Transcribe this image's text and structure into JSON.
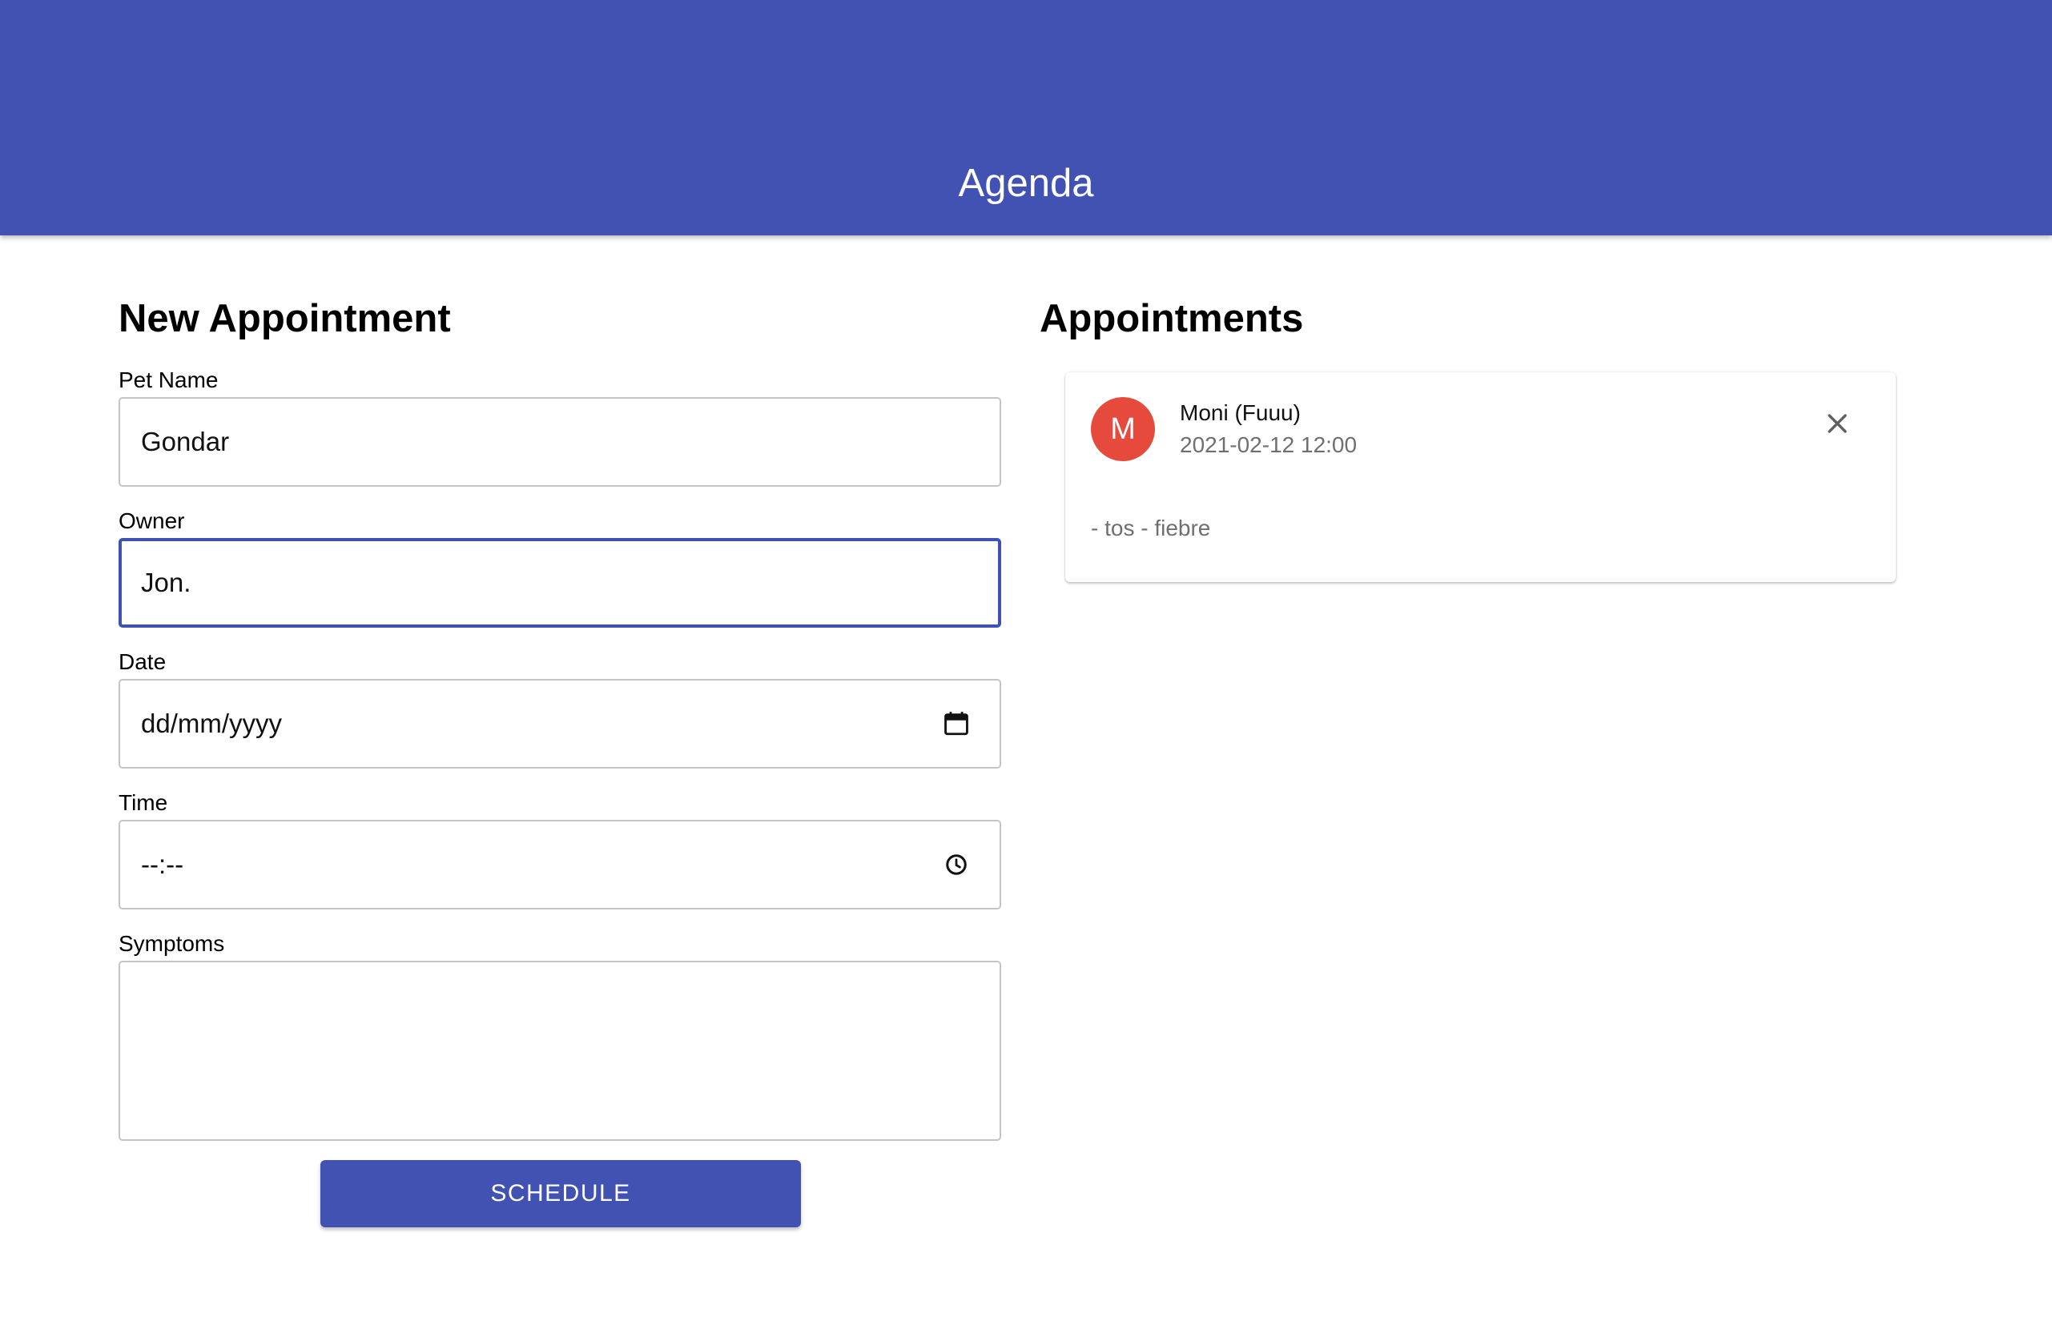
{
  "header": {
    "title": "Agenda",
    "background_color": "#4252b3"
  },
  "form": {
    "heading": "New Appointment",
    "pet_name": {
      "label": "Pet Name",
      "value": "Gondar"
    },
    "owner": {
      "label": "Owner",
      "value": "Jon.",
      "focused": true
    },
    "date": {
      "label": "Date",
      "value": "dd/mm/yyyy",
      "icon": "calendar-icon"
    },
    "time": {
      "label": "Time",
      "value": "--:--",
      "icon": "clock-icon"
    },
    "symptoms": {
      "label": "Symptoms",
      "value": ""
    },
    "submit_label": "SCHEDULE"
  },
  "appointments": {
    "heading": "Appointments",
    "items": [
      {
        "avatar_letter": "M",
        "avatar_color": "#e64a3c",
        "title": "Moni (Fuuu)",
        "datetime": "2021-02-12 12:00",
        "symptoms": "- tos - fiebre",
        "action_icon": "close-icon"
      }
    ]
  }
}
